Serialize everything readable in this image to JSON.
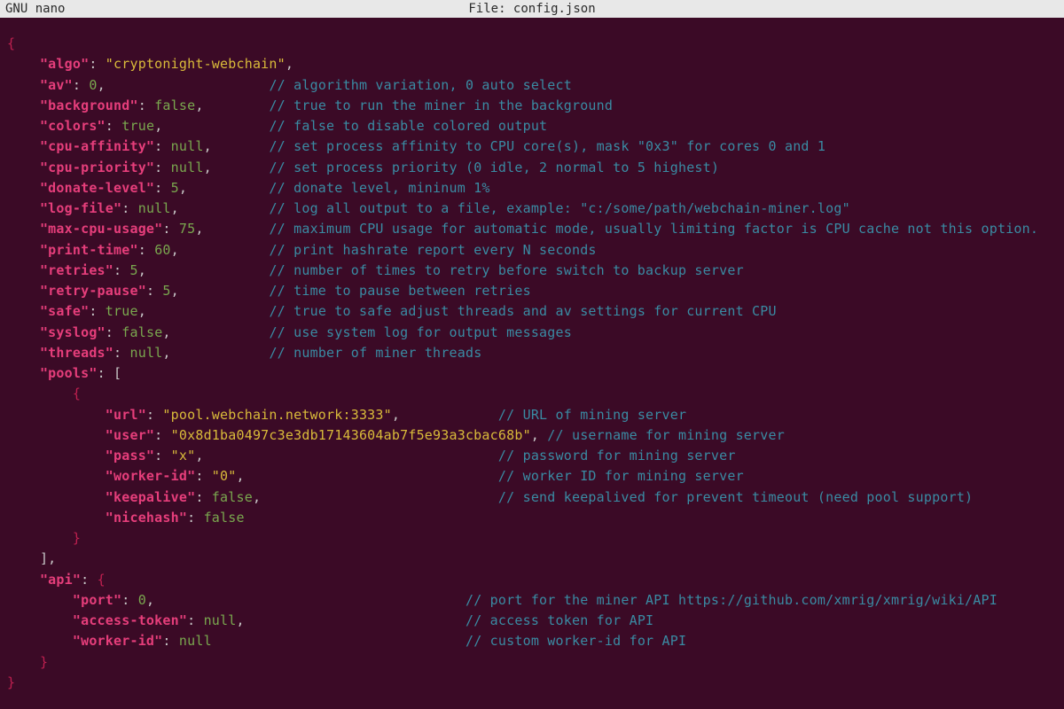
{
  "titlebar": {
    "app": "GNU nano",
    "file_label": "File: config.json"
  },
  "colors": {
    "bg": "#3b0a26",
    "key": "#e63e7b",
    "string": "#d9bb3a",
    "value": "#7aa84f",
    "comment": "#3a8ba3",
    "brace": "#c02050"
  },
  "config": {
    "algo": {
      "key": "\"algo\"",
      "value": "\"cryptonight-webchain\"",
      "vtype": "str",
      "comma": true,
      "comment": ""
    },
    "av": {
      "key": "\"av\"",
      "value": "0",
      "vtype": "num",
      "comma": true,
      "comment": "// algorithm variation, 0 auto select"
    },
    "background": {
      "key": "\"background\"",
      "value": "false",
      "vtype": "bool",
      "comma": true,
      "comment": "// true to run the miner in the background"
    },
    "colors": {
      "key": "\"colors\"",
      "value": "true",
      "vtype": "bool",
      "comma": true,
      "comment": "// false to disable colored output"
    },
    "cpu_affinity": {
      "key": "\"cpu-affinity\"",
      "value": "null",
      "vtype": "null",
      "comma": true,
      "comment": "// set process affinity to CPU core(s), mask \"0x3\" for cores 0 and 1"
    },
    "cpu_priority": {
      "key": "\"cpu-priority\"",
      "value": "null",
      "vtype": "null",
      "comma": true,
      "comment": "// set process priority (0 idle, 2 normal to 5 highest)"
    },
    "donate_level": {
      "key": "\"donate-level\"",
      "value": "5",
      "vtype": "num",
      "comma": true,
      "comment": "// donate level, mininum 1%"
    },
    "log_file": {
      "key": "\"log-file\"",
      "value": "null",
      "vtype": "null",
      "comma": true,
      "comment": "// log all output to a file, example: \"c:/some/path/webchain-miner.log\""
    },
    "max_cpu": {
      "key": "\"max-cpu-usage\"",
      "value": "75",
      "vtype": "num",
      "comma": true,
      "comment": "// maximum CPU usage for automatic mode, usually limiting factor is CPU cache not this option."
    },
    "print_time": {
      "key": "\"print-time\"",
      "value": "60",
      "vtype": "num",
      "comma": true,
      "comment": "// print hashrate report every N seconds"
    },
    "retries": {
      "key": "\"retries\"",
      "value": "5",
      "vtype": "num",
      "comma": true,
      "comment": "// number of times to retry before switch to backup server"
    },
    "retry_pause": {
      "key": "\"retry-pause\"",
      "value": "5",
      "vtype": "num",
      "comma": true,
      "comment": "// time to pause between retries"
    },
    "safe": {
      "key": "\"safe\"",
      "value": "true",
      "vtype": "bool",
      "comma": true,
      "comment": "// true to safe adjust threads and av settings for current CPU"
    },
    "syslog": {
      "key": "\"syslog\"",
      "value": "false",
      "vtype": "bool",
      "comma": true,
      "comment": "// use system log for output messages"
    },
    "threads": {
      "key": "\"threads\"",
      "value": "null",
      "vtype": "null",
      "comma": true,
      "comment": "// number of miner threads"
    },
    "pools_key": "\"pools\"",
    "pool": {
      "url": {
        "key": "\"url\"",
        "value": "\"pool.webchain.network:3333\"",
        "vtype": "str",
        "comma": true,
        "comment": "// URL of mining server"
      },
      "user": {
        "key": "\"user\"",
        "value": "\"0x8d1ba0497c3e3db17143604ab7f5e93a3cbac68b\"",
        "vtype": "str",
        "comma": true,
        "comment": "// username for mining server"
      },
      "pass": {
        "key": "\"pass\"",
        "value": "\"x\"",
        "vtype": "str",
        "comma": true,
        "comment": "// password for mining server"
      },
      "worker": {
        "key": "\"worker-id\"",
        "value": "\"0\"",
        "vtype": "str",
        "comma": true,
        "comment": "// worker ID for mining server"
      },
      "keepalive": {
        "key": "\"keepalive\"",
        "value": "false",
        "vtype": "bool",
        "comma": true,
        "comment": "// send keepalived for prevent timeout (need pool support)"
      },
      "nicehash": {
        "key": "\"nicehash\"",
        "value": "false",
        "vtype": "bool",
        "comma": false,
        "comment": ""
      }
    },
    "api_key": "\"api\"",
    "api": {
      "port": {
        "key": "\"port\"",
        "value": "0",
        "vtype": "num",
        "comma": true,
        "comment": "// port for the miner API https://github.com/xmrig/xmrig/wiki/API"
      },
      "token": {
        "key": "\"access-token\"",
        "value": "null",
        "vtype": "null",
        "comma": true,
        "comment": "// access token for API"
      },
      "worker": {
        "key": "\"worker-id\"",
        "value": "null",
        "vtype": "null",
        "comma": false,
        "comment": "// custom worker-id for API"
      }
    }
  },
  "layout": {
    "col_comment_main": 28,
    "col_comment_pool": 48
  }
}
